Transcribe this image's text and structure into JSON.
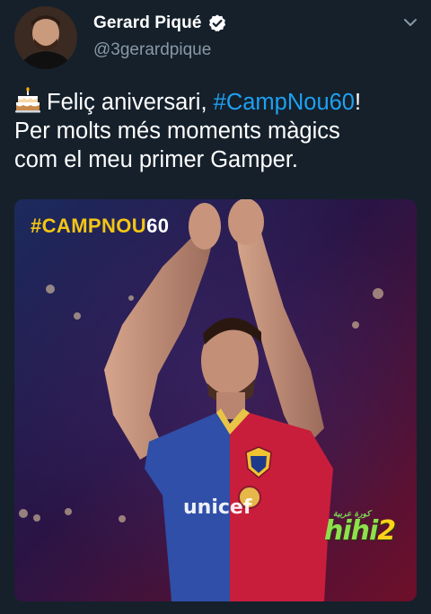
{
  "user": {
    "display_name": "Gerard Piqué",
    "handle": "@3gerardpique",
    "verified": true
  },
  "icons": {
    "verified": "verified-badge-icon",
    "menu": "chevron-down-icon",
    "emoji": "birthday-cake-emoji"
  },
  "tweet": {
    "line1_prefix": "Feliç aniversari, ",
    "hashtag": "#CampNou60",
    "line1_suffix": "!",
    "line2": "Per molts més moments màgics",
    "line3": "com el meu primer Gamper."
  },
  "media": {
    "hashtag_text": "#CAMPNOU",
    "hashtag_number": "60",
    "shirt_sponsor": "unicef",
    "watermark_small": "كورة عربية",
    "watermark_main": "hihi",
    "watermark_digit": "2"
  },
  "colors": {
    "background": "#15202b",
    "secondary_text": "#8899a6",
    "link": "#1da1f2",
    "media_hashtag": "#f3c614"
  }
}
